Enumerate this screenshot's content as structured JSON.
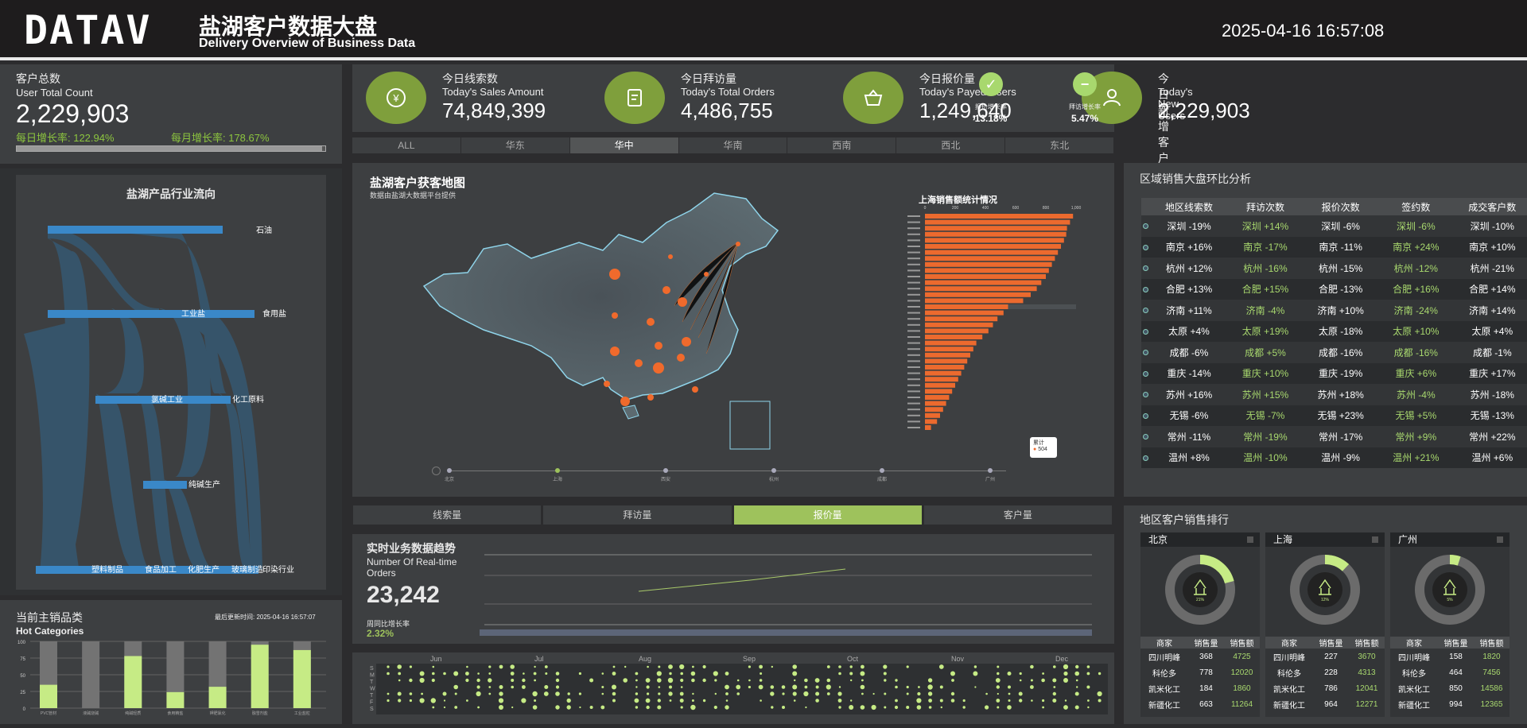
{
  "header": {
    "logo": "DATAV",
    "title": "盐湖客户数据大盘",
    "subtitle": "Delivery Overview of Business Data",
    "datetime": "2025-04-16 16:57:08"
  },
  "customers": {
    "title_cn": "客户总数",
    "title_en": "User Total Count",
    "value": "2,229,903",
    "daily": "每日增长率: 122.94%",
    "monthly": "每月增长率: 178.67%",
    "progress": 0.99
  },
  "sankey": {
    "title": "盐湖产品行业流向",
    "nodes": [
      "石油",
      "工业盐",
      "食用盐",
      "氯碱工业",
      "化工原料",
      "纯碱生产",
      "塑料制品",
      "食品加工",
      "化肥生产",
      "玻璃制造",
      "印染行业"
    ]
  },
  "hot": {
    "title_cn": "当前主销品类",
    "title_en": "Hot Categories",
    "updated": "最后更新时间: 2025-04-16 16:57:07",
    "yticks": [
      "100",
      "75",
      "50",
      "25",
      "0"
    ],
    "cats": [
      "PVC管材",
      "液碱烧碱",
      "纯碱轻质",
      "食用精盐",
      "钾肥氯化",
      "融雪剂盐",
      "工业盐粒"
    ],
    "values": [
      35,
      0,
      78,
      24,
      32,
      95,
      87
    ]
  },
  "kpis": [
    {
      "cn": "今日线索数",
      "en": "Today's Sales Amount",
      "value": "74,849,399",
      "icon": "yen-icon"
    },
    {
      "cn": "今日拜访量",
      "en": "Today's Total Orders",
      "value": "4,486,755",
      "icon": "document-icon"
    },
    {
      "cn": "今日报价量",
      "en": "Today's Payed Users",
      "value": "1,249,640",
      "icon": "basket-icon"
    },
    {
      "cn": "今日新增客户数",
      "en": "Today's New Users",
      "value": "2,229,903",
      "icon": "user-icon"
    }
  ],
  "rates": [
    {
      "label": "报价增长率",
      "value": "13.18%"
    },
    {
      "label": "拜访增长率",
      "value": "5.47%"
    }
  ],
  "regions": [
    "ALL",
    "华东",
    "华中",
    "华南",
    "西南",
    "西北",
    "东北"
  ],
  "map": {
    "title": "盐湖客户获客地图",
    "subtitle": "数据由盐湖大数据平台提供",
    "bar_title": "上海销售额统计情况",
    "bar_ticks": [
      "0",
      "200",
      "400",
      "600",
      "800",
      "1,000"
    ],
    "legend_title": "累计",
    "legend_value": "504",
    "timeline": [
      "北京",
      "上海",
      "西安",
      "杭州",
      "成都",
      "广州"
    ],
    "bar_values": [
      980,
      960,
      940,
      935,
      920,
      900,
      880,
      860,
      840,
      820,
      800,
      770,
      740,
      700,
      650,
      550,
      520,
      480,
      450,
      420,
      380,
      340,
      320,
      300,
      280,
      260,
      240,
      220,
      200,
      180,
      160,
      140,
      120,
      100,
      80,
      40
    ]
  },
  "metric_tabs": [
    "线索量",
    "拜访量",
    "报价量",
    "客户量"
  ],
  "trend": {
    "title": "实时业务数据趋势",
    "sub": "Number Of Real-time Orders",
    "value": "23,242",
    "rate_label": "周同比增长率",
    "rate": "2.32%"
  },
  "calendar": {
    "months": [
      "Jun",
      "Jul",
      "Aug",
      "Sep",
      "Oct",
      "Nov",
      "Dec"
    ],
    "days": [
      "S",
      "M",
      "T",
      "W",
      "T",
      "F",
      "S"
    ]
  },
  "ratio": {
    "title": "区域销售大盘环比分析",
    "headers": [
      "地区线索数",
      "拜访次数",
      "报价次数",
      "签约数",
      "成交客户数"
    ],
    "rows": [
      [
        "深圳 -19%",
        "深圳 +14%",
        "深圳 -6%",
        "深圳 -6%",
        "深圳 -10%"
      ],
      [
        "南京 +16%",
        "南京 -17%",
        "南京 -11%",
        "南京 +24%",
        "南京 +10%"
      ],
      [
        "杭州 +12%",
        "杭州 -16%",
        "杭州 -15%",
        "杭州 -12%",
        "杭州 -21%"
      ],
      [
        "合肥 +13%",
        "合肥 +15%",
        "合肥 -13%",
        "合肥 +16%",
        "合肥 +14%"
      ],
      [
        "济南 +11%",
        "济南 -4%",
        "济南 +10%",
        "济南 -24%",
        "济南 +14%"
      ],
      [
        "太原 +4%",
        "太原 +19%",
        "太原 -18%",
        "太原 +10%",
        "太原 +4%"
      ],
      [
        "成都 -6%",
        "成都 +5%",
        "成都 -16%",
        "成都 -16%",
        "成都 -1%"
      ],
      [
        "重庆 -14%",
        "重庆 +10%",
        "重庆 -19%",
        "重庆 +6%",
        "重庆 +17%"
      ],
      [
        "苏州 +16%",
        "苏州 +15%",
        "苏州 +18%",
        "苏州 -4%",
        "苏州 -18%"
      ],
      [
        "无锡 -6%",
        "无锡 -7%",
        "无锡 +23%",
        "无锡 +5%",
        "无锡 -13%"
      ],
      [
        "常州 -11%",
        "常州 -19%",
        "常州 -17%",
        "常州 +9%",
        "常州 +22%"
      ],
      [
        "温州 +8%",
        "温州 -10%",
        "温州 -9%",
        "温州 +21%",
        "温州 +6%"
      ]
    ]
  },
  "ranking": {
    "title": "地区客户销售排行",
    "headers": [
      "商家",
      "销售量",
      "销售额"
    ],
    "cities": [
      {
        "name": "北京",
        "pct": "21%",
        "share": 0.21,
        "rows": [
          [
            "四川明峰",
            "368",
            "4725"
          ],
          [
            "科伦多",
            "778",
            "12020"
          ],
          [
            "凯米化工",
            "184",
            "1860"
          ],
          [
            "新疆化工",
            "663",
            "11264"
          ]
        ]
      },
      {
        "name": "上海",
        "pct": "12%",
        "share": 0.12,
        "rows": [
          [
            "四川明峰",
            "227",
            "3670"
          ],
          [
            "科伦多",
            "228",
            "4313"
          ],
          [
            "凯米化工",
            "786",
            "12041"
          ],
          [
            "新疆化工",
            "964",
            "12271"
          ]
        ]
      },
      {
        "name": "广州",
        "pct": "5%",
        "share": 0.05,
        "rows": [
          [
            "四川明峰",
            "158",
            "1820"
          ],
          [
            "科伦多",
            "464",
            "7456"
          ],
          [
            "凯米化工",
            "850",
            "14586"
          ],
          [
            "新疆化工",
            "994",
            "12365"
          ]
        ]
      }
    ]
  }
}
